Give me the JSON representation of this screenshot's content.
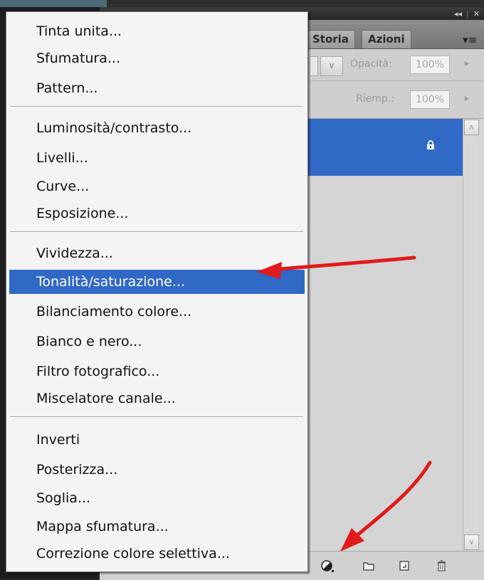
{
  "panel": {
    "tabs": [
      "Storia",
      "Azioni"
    ],
    "window_controls": [
      "◂◂",
      "|",
      "✕"
    ],
    "menu_button": "▾≡",
    "options": {
      "opacity_label": "Opacità:",
      "opacity_value": "100%",
      "fill_label": "Riemp.:",
      "fill_value": "100%"
    }
  },
  "menu": {
    "groups": [
      [
        "Tinta unita...",
        "Sfumatura...",
        "Pattern..."
      ],
      [
        "Luminosità/contrasto...",
        "Livelli...",
        "Curve...",
        "Esposizione..."
      ],
      [
        "Vividezza...",
        "Tonalità/saturazione...",
        "Bilanciamento colore...",
        "Bianco e nero...",
        "Filtro fotografico...",
        "Miscelatore canale..."
      ],
      [
        "Inverti",
        "Posterizza...",
        "Soglia...",
        "Mappa sfumatura...",
        "Correzione colore selettiva..."
      ]
    ],
    "highlighted": "Tonalità/saturazione..."
  },
  "colors": {
    "highlight": "#3169c6",
    "arrow": "#e01b1b"
  },
  "icons": {
    "adjustment_layer": "half-filled-circle",
    "group": "folder",
    "new_layer": "page",
    "delete": "trash",
    "lock": "padlock"
  }
}
